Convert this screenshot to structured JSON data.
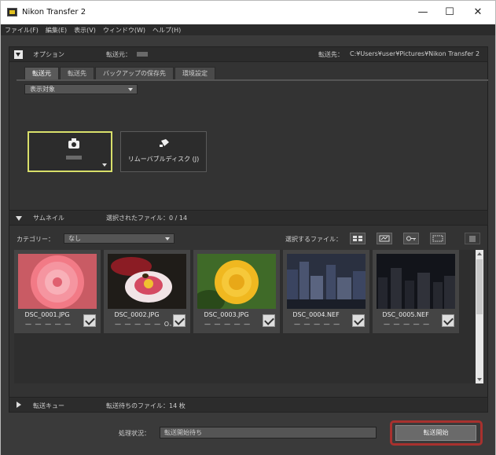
{
  "window": {
    "title": "Nikon Transfer 2",
    "controls": {
      "minimize": "—",
      "maximize": "☐",
      "close": "✕"
    }
  },
  "menu": [
    "ファイル(F)",
    "編集(E)",
    "表示(V)",
    "ウィンドウ(W)",
    "ヘルプ(H)"
  ],
  "options": {
    "header_label": "オプション",
    "source_label": "転送元：",
    "dest_label": "転送先：",
    "dest_path": "C:¥Users¥user¥Pictures¥Nikon Transfer 2",
    "tabs": [
      "転送元",
      "転送先",
      "バックアップの保存先",
      "環境設定"
    ],
    "active_tab": 0,
    "display_select": "表示対象",
    "removable_label": "リムーバブルディスク (J)"
  },
  "thumbnail": {
    "header_label": "サムネイル",
    "selected_files": "選択されたファイル：0 / 14",
    "category_label": "カテゴリー：",
    "category_value": "なし",
    "select_files_label": "選択するファイル："
  },
  "files": [
    {
      "name": "DSC_0001.JPG",
      "checked": true,
      "protected": false,
      "image": "pink-dahlia"
    },
    {
      "name": "DSC_0002.JPG",
      "checked": true,
      "protected": true,
      "image": "red-flower-bee"
    },
    {
      "name": "DSC_0003.JPG",
      "checked": true,
      "protected": false,
      "image": "yellow-rose"
    },
    {
      "name": "DSC_0004.NEF",
      "checked": true,
      "protected": false,
      "image": "night-city"
    },
    {
      "name": "DSC_0005.NEF",
      "checked": true,
      "protected": false,
      "image": "night-city-dark"
    }
  ],
  "queue": {
    "header_label": "転送キュー",
    "pending_files": "転送待ちのファイル：14 枚"
  },
  "status": {
    "label": "処理状況：",
    "value": "転送開始待ち",
    "start_button": "転送開始"
  },
  "colors": {
    "highlight_border": "#a8312e",
    "selected_source": "#d9e06a"
  }
}
